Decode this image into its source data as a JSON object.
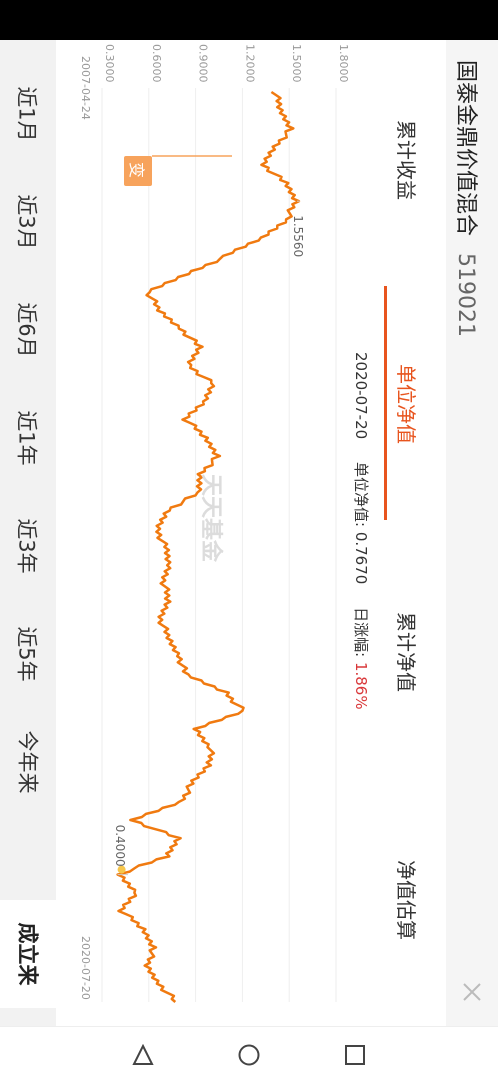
{
  "fund": {
    "name": "国泰金鼎价值混合",
    "code": "519021"
  },
  "tabs": [
    {
      "label": "累计收益",
      "active": false
    },
    {
      "label": "单位净值",
      "active": true
    },
    {
      "label": "累计净值",
      "active": false
    },
    {
      "label": "净值估算",
      "active": false
    }
  ],
  "info": {
    "date": "2020-07-20",
    "nav_label": "单位净值:",
    "nav_value": "0.7670",
    "change_label": "日涨幅:",
    "change_value": "1.86%"
  },
  "periods": [
    "近1月",
    "近3月",
    "近6月",
    "近1年",
    "近3年",
    "近5年",
    "今年来",
    "成立来"
  ],
  "active_period": "成立来",
  "watermark": "天天基金",
  "marker": {
    "label": "变"
  },
  "colors": {
    "line": "#f07a10",
    "accent": "#e8541e",
    "change": "#d9383a"
  },
  "chart_data": {
    "type": "line",
    "x_start": "2007-04-24",
    "x_end": "2020-07-20",
    "ylim": [
      0.3,
      1.8
    ],
    "yticks": [
      "0.3000",
      "0.6000",
      "0.9000",
      "1.2000",
      "1.5000",
      "1.8000"
    ],
    "max_label": "1.5560",
    "min_label": "0.4000",
    "values": [
      1.41,
      1.44,
      1.52,
      1.4,
      1.34,
      1.47,
      1.55,
      1.48,
      1.33,
      1.1,
      0.84,
      0.6,
      0.66,
      0.81,
      0.92,
      0.86,
      1.0,
      0.96,
      0.84,
      0.96,
      1.05,
      0.92,
      0.93,
      0.71,
      0.66,
      0.7,
      0.73,
      0.7,
      0.72,
      0.68,
      0.72,
      0.8,
      0.83,
      1.1,
      1.2,
      0.9,
      1.0,
      0.98,
      0.88,
      0.8,
      0.5,
      0.78,
      0.72,
      0.4,
      0.52,
      0.43,
      0.56,
      0.64,
      0.58,
      0.67,
      0.77
    ]
  },
  "icons": {
    "close": "close-icon",
    "back": "triangle-back-icon",
    "home": "circle-home-icon",
    "recent": "square-recent-icon"
  }
}
